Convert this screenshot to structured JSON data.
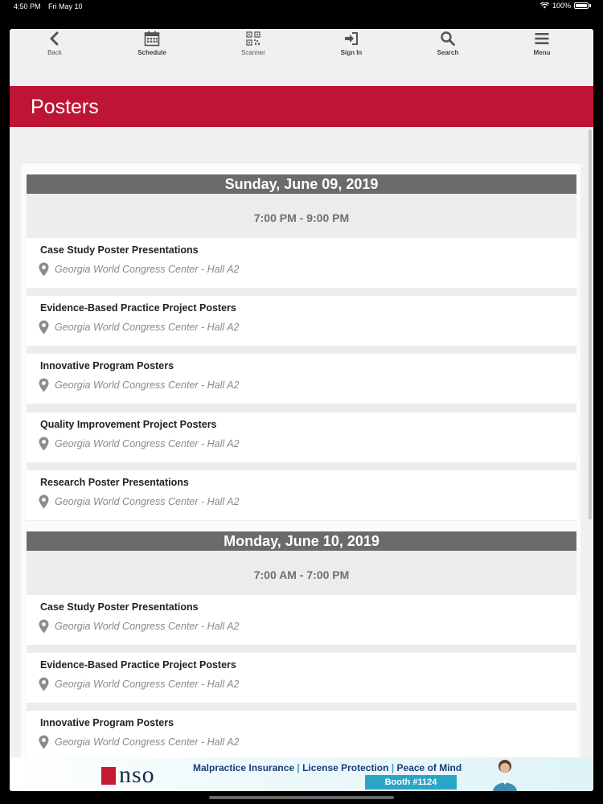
{
  "status_bar": {
    "time": "4:50 PM",
    "date": "Fri May 10",
    "battery": "100%"
  },
  "nav": {
    "items": [
      {
        "label": "Back",
        "icon": "chevron-left-icon"
      },
      {
        "label": "Schedule",
        "icon": "calendar-icon"
      },
      {
        "label": "Scanner",
        "icon": "qr-code-icon"
      },
      {
        "label": "Sign In",
        "icon": "sign-in-icon"
      },
      {
        "label": "Search",
        "icon": "search-icon"
      },
      {
        "label": "Menu",
        "icon": "hamburger-menu-icon"
      }
    ]
  },
  "header": {
    "title": "Posters"
  },
  "colors": {
    "brand_red": "#bd1533",
    "day_bar": "#6b6b6b"
  },
  "days": [
    {
      "date": "Sunday, June 09, 2019",
      "time_range": "7:00 PM - 9:00 PM",
      "sessions": [
        {
          "title": "Case Study Poster Presentations",
          "location": "Georgia World Congress Center - Hall A2"
        },
        {
          "title": "Evidence-Based Practice Project Posters",
          "location": "Georgia World Congress Center - Hall A2"
        },
        {
          "title": "Innovative Program Posters",
          "location": "Georgia World Congress Center - Hall A2"
        },
        {
          "title": "Quality Improvement Project Posters",
          "location": "Georgia World Congress Center - Hall A2"
        },
        {
          "title": "Research Poster Presentations",
          "location": "Georgia World Congress Center - Hall A2"
        }
      ]
    },
    {
      "date": "Monday, June 10, 2019",
      "time_range": "7:00 AM - 7:00 PM",
      "sessions": [
        {
          "title": "Case Study Poster Presentations",
          "location": "Georgia World Congress Center - Hall A2"
        },
        {
          "title": "Evidence-Based Practice Project Posters",
          "location": "Georgia World Congress Center - Hall A2"
        },
        {
          "title": "Innovative Program Posters",
          "location": "Georgia World Congress Center - Hall A2"
        }
      ]
    }
  ],
  "ad": {
    "logo": "nso",
    "tagline_1": "Malpractice Insurance",
    "tagline_sep": "|",
    "tagline_2": "License Protection",
    "tagline_3": "Peace of Mind",
    "booth": "Booth #1124"
  }
}
